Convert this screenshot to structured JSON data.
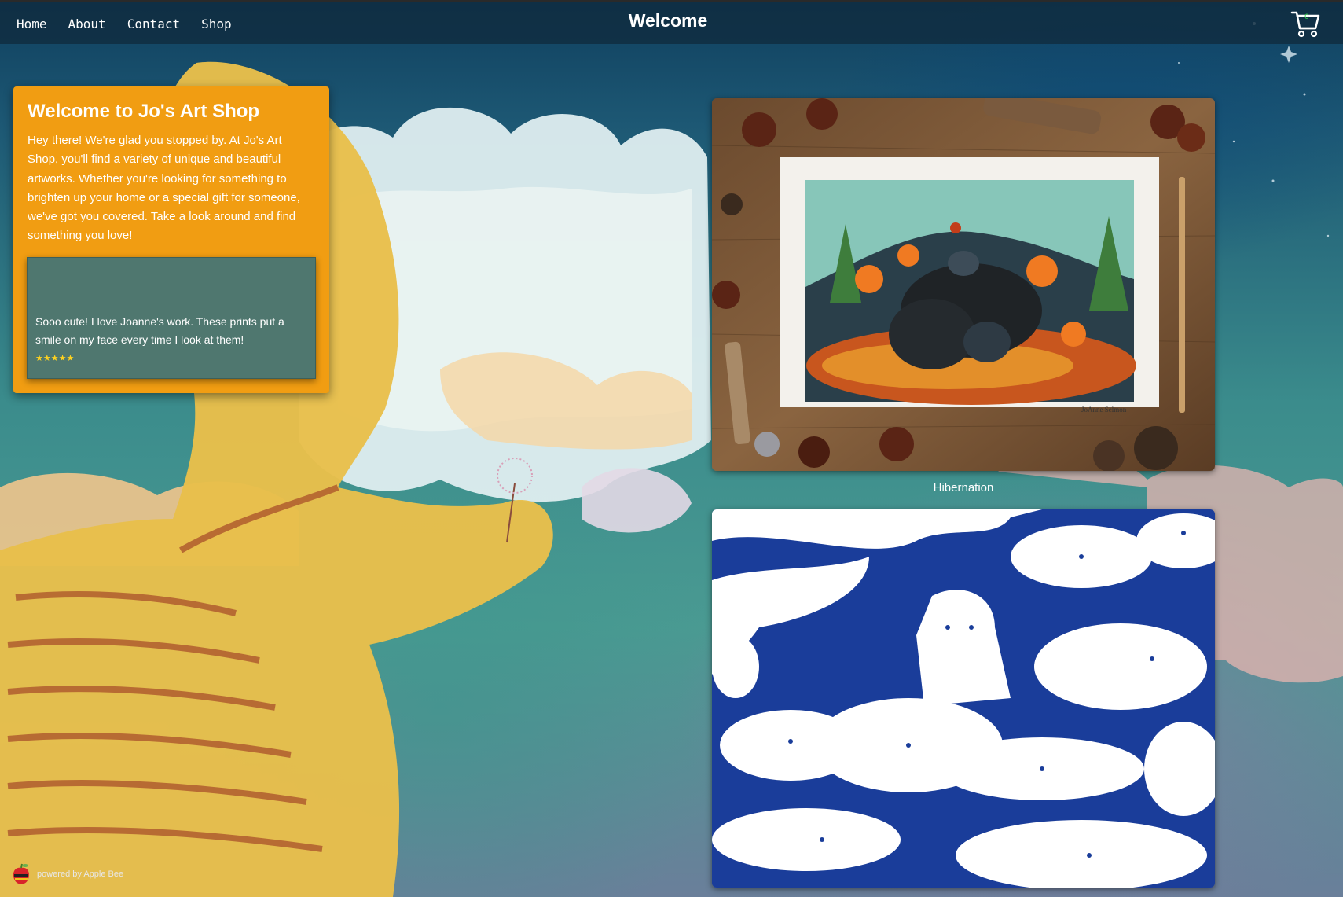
{
  "nav": {
    "links": [
      "Home",
      "About",
      "Contact",
      "Shop"
    ],
    "title": "Welcome",
    "cart_count": "0"
  },
  "welcome": {
    "title": "Welcome to Jo's Art Shop",
    "text": "Hey there! We're glad you stopped by. At Jo's Art Shop, you'll find a variety of unique and beautiful artworks. Whether you're looking for something to brighten up your home or a special gift for someone, we've got you covered. Take a look around and find something you love!"
  },
  "review": {
    "text": "Sooo cute! I love Joanne's work. These prints put a smile on my face every time I look at them!",
    "stars": "★★★★★"
  },
  "gallery": {
    "items": [
      {
        "caption": "Hibernation",
        "signature": "JoAnne Selmon"
      },
      {
        "caption": ""
      }
    ]
  },
  "footer": {
    "powered_by": "powered by Apple Bee"
  },
  "colors": {
    "card": "#f19d12",
    "review": "#4f776f",
    "nav": "#102c40",
    "cart_badge": "#2fd14a",
    "stars": "#ffd21f"
  },
  "icons": [
    "cart-icon",
    "apple-bee-logo-icon"
  ]
}
